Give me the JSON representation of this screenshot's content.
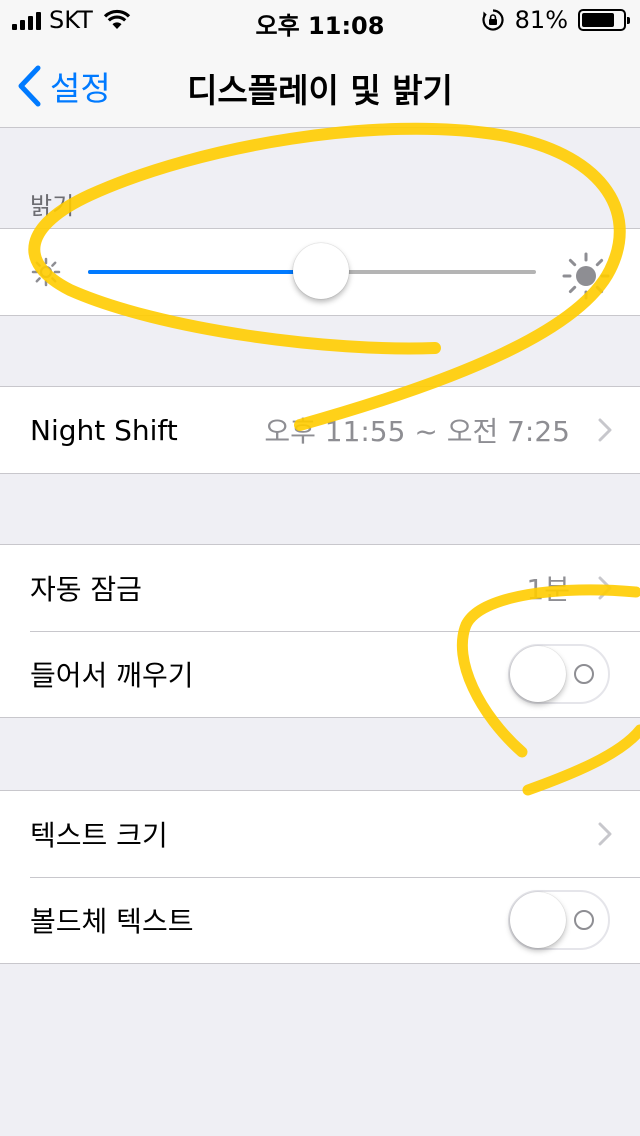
{
  "status_bar": {
    "carrier": "SKT",
    "time": "오후 11:08",
    "battery_percent": "81%",
    "battery_level": 0.81
  },
  "nav": {
    "back_label": "설정",
    "title": "디스플레이 및 밝기"
  },
  "brightness": {
    "header": "밝기",
    "level": 0.52,
    "track_fill_color": "#007aff",
    "small_icon": "sun-dim-icon",
    "large_icon": "sun-bright-icon"
  },
  "night_shift": {
    "label": "Night Shift",
    "value": "오후 11:55 ~ 오전 7:25"
  },
  "lock_group": {
    "auto_lock_label": "자동 잠금",
    "auto_lock_value": "1분",
    "raise_to_wake_label": "들어서 깨우기",
    "raise_to_wake_on": false
  },
  "text_group": {
    "text_size_label": "텍스트 크기",
    "bold_text_label": "볼드체 텍스트",
    "bold_text_on": false
  },
  "colors": {
    "accent": "#007aff",
    "annotation": "#ffcc00",
    "background": "#efeff4"
  }
}
